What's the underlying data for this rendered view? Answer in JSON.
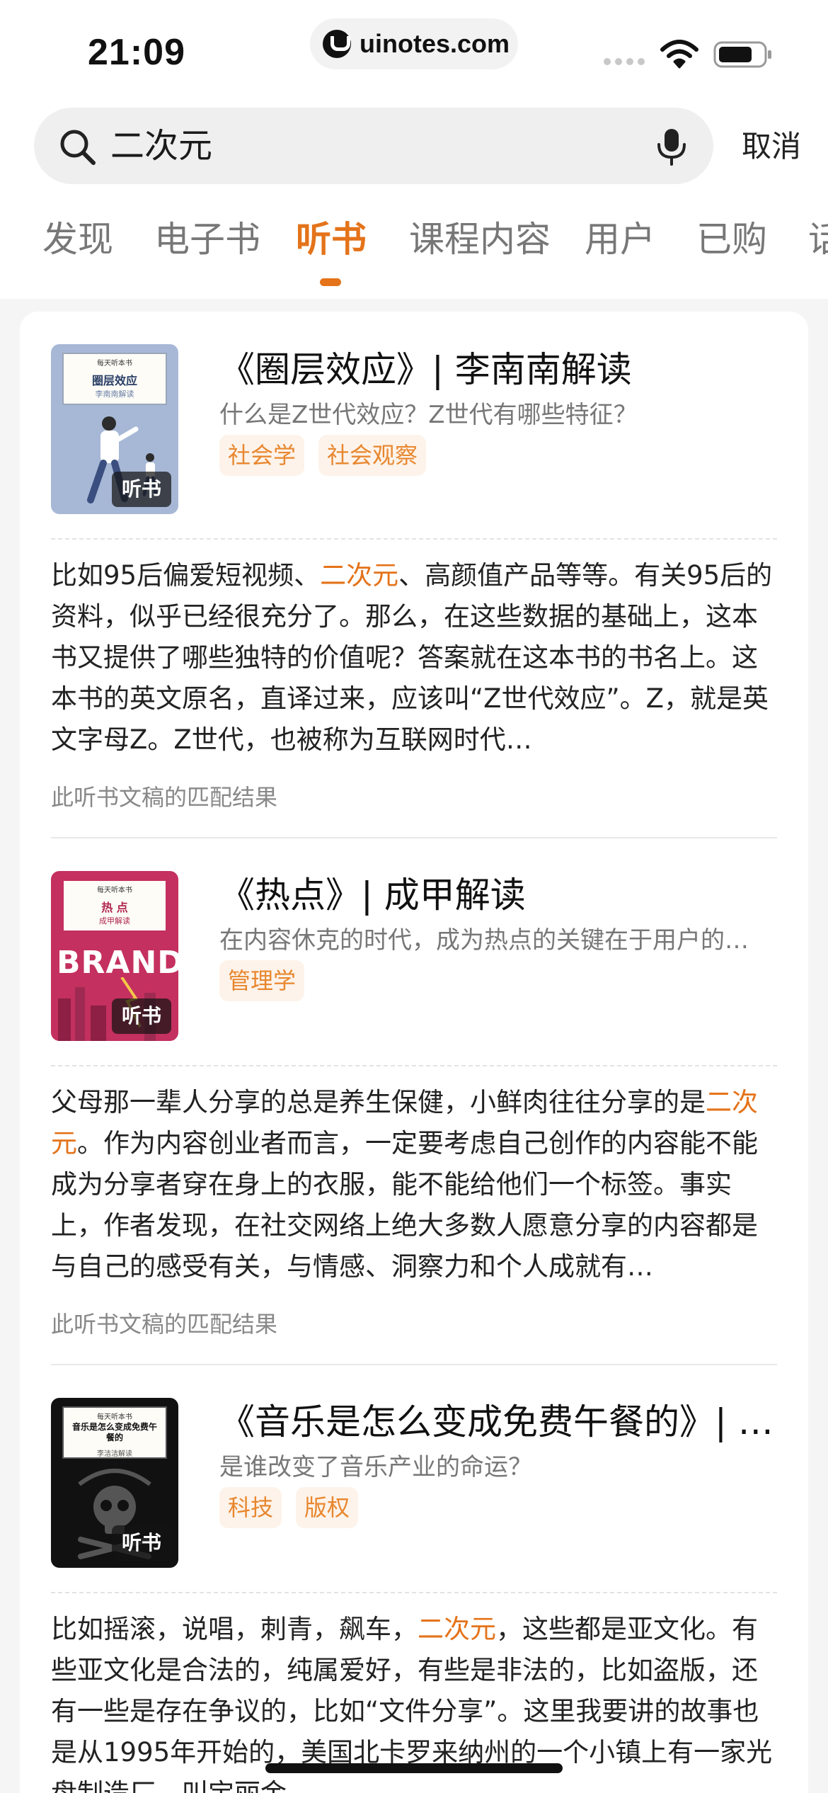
{
  "status_bar": {
    "time": "21:09",
    "url": "uinotes.com",
    "icons": [
      "signal-icon",
      "wifi-icon",
      "battery-icon"
    ]
  },
  "search": {
    "query": "二次元",
    "cancel_label": "取消",
    "icons": [
      "search-icon",
      "mic-icon"
    ]
  },
  "tabs": [
    {
      "label": "发现"
    },
    {
      "label": "电子书"
    },
    {
      "label": "听书",
      "active": true
    },
    {
      "label": "课程内容"
    },
    {
      "label": "用户"
    },
    {
      "label": "已购"
    },
    {
      "label": "话"
    }
  ],
  "colors": {
    "accent": "#e4731a",
    "tag_bg": "#fdf3ea",
    "tag_text": "#e8872f"
  },
  "results": [
    {
      "title": "《圈层效应》| 李南南解读",
      "subtitle": "什么是Z世代效应？Z世代有哪些特征？",
      "tags": [
        "社会学",
        "社会观察"
      ],
      "cover": {
        "top": "每天听本书",
        "title": "圈层效应",
        "sub": "李南南解读",
        "badge": "听书"
      },
      "excerpt_before": "比如95后偏爱短视频、",
      "excerpt_highlight": "二次元",
      "excerpt_after": "、高颜值产品等等。有关95后的资料，似乎已经很充分了。那么，在这些数据的基础上，这本书又提供了哪些独特的价值呢？答案就在这本书的书名上。这本书的英文原名，直译过来，应该叫“Z世代效应”。Z，就是英文字母Z。Z世代，也被称为互联网时代…",
      "match_note": "此听书文稿的匹配结果"
    },
    {
      "title": "《热点》| 成甲解读",
      "subtitle": "在内容休克的时代，成为热点的关键在于用户的…",
      "tags": [
        "管理学"
      ],
      "cover": {
        "top": "每天听本书",
        "title": "热 点",
        "sub": "成甲解读",
        "art": "BRAND",
        "badge": "听书"
      },
      "excerpt_before": "父母那一辈人分享的总是养生保健，小鲜肉往往分享的是",
      "excerpt_highlight": "二次元",
      "excerpt_after": "。作为内容创业者而言，一定要考虑自己创作的内容能不能成为分享者穿在身上的衣服，能不能给他们一个标签。事实上，作者发现，在社交网络上绝大多数人愿意分享的内容都是与自己的感受有关，与情感、洞察力和个人成就有…",
      "match_note": "此听书文稿的匹配结果"
    },
    {
      "title": "《音乐是怎么变成免费午餐的》| 李…",
      "subtitle": "是谁改变了音乐产业的命运？",
      "tags": [
        "科技",
        "版权"
      ],
      "cover": {
        "top": "每天听本书",
        "title": "音乐是怎么变成免费午餐的",
        "sub": "李洁洁解读",
        "badge": "听书"
      },
      "excerpt_before": "比如摇滚，说唱，刺青，飙车，",
      "excerpt_highlight": "二次元",
      "excerpt_after": "，这些都是亚文化。有些亚文化是合法的，纯属爱好，有些是非法的，比如盗版，还有一些是存在争议的，比如“文件分享”。这里我要讲的故事也是从1995年开始的，美国北卡罗来纳州的一个小镇上有一家光盘制造厂，叫宝丽金",
      "match_note": "此听书文稿的匹配结果"
    }
  ]
}
